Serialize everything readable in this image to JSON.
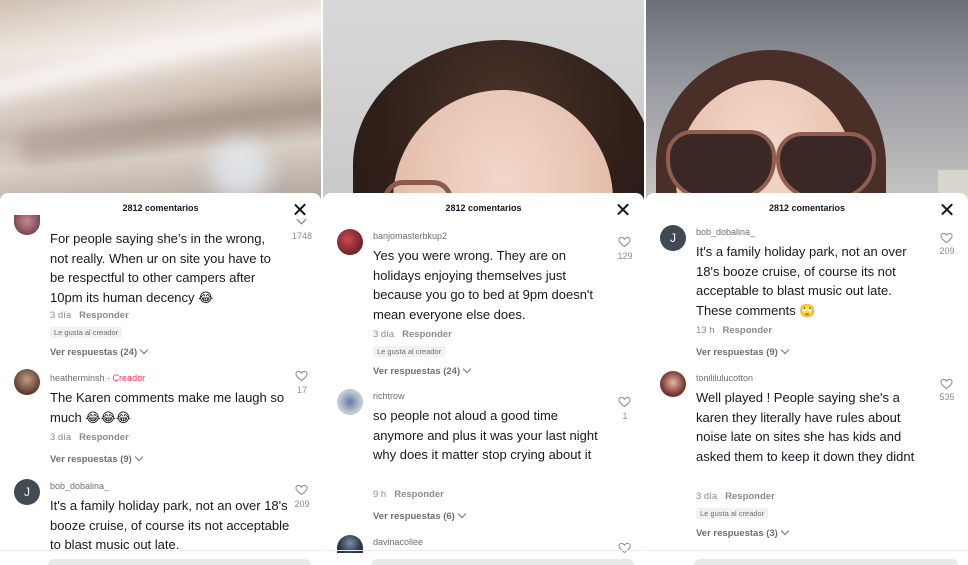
{
  "panels": [
    {
      "comment_count": "2812 comentarios",
      "comments": [
        {
          "text": "For people saying she’s in the wrong, not really. When ur on site you have to be respectful to other campers after 10pm its human decency 😂",
          "time": "3 día",
          "reply": "Responder",
          "liked_badge": "Le gusta al creador",
          "view_replies": "Ver respuestas (24)",
          "likes": "1748"
        },
        {
          "username": "heatherminsh",
          "creator_tag": "· Creador",
          "text": "The Karen comments make me laugh so much 😂😂😂",
          "time": "3 día",
          "reply": "Responder",
          "view_replies": "Ver respuestas (9)",
          "likes": "17"
        },
        {
          "username": "bob_dobalina_",
          "avatar_letter": "J",
          "text": "It's a family holiday park, not an over 18's booze cruise, of course its not acceptable to blast music out late.",
          "likes": "209"
        }
      ]
    },
    {
      "comment_count": "2812 comentarios",
      "comments": [
        {
          "username": "banjomasterbkup2",
          "text": "Yes you were wrong. They are on holidays enjoying themselves just because you go to bed at 9pm doesn't mean everyone else does.",
          "time": "3 día",
          "reply": "Responder",
          "liked_badge": "Le gusta al creador",
          "view_replies": "Ver respuestas (24)",
          "likes": "129"
        },
        {
          "username": "richtrow",
          "text": "so people not aloud a good time anymore and plus it was your last night why does it matter stop crying about it",
          "time": "9 h",
          "reply": "Responder",
          "view_replies": "Ver respuestas (6)",
          "likes": "1"
        },
        {
          "username": "davinacollee"
        }
      ]
    },
    {
      "comment_count": "2812 comentarios",
      "comments": [
        {
          "username": "bob_dobalina_",
          "avatar_letter": "J",
          "text": "It's a family holiday park, not an over 18's booze cruise, of course its not acceptable to blast music out late. These comments 🙄",
          "time": "13 h",
          "reply": "Responder",
          "view_replies": "Ver respuestas (9)",
          "likes": "209"
        },
        {
          "username": "tonililulucotton",
          "text": "Well played ! People saying she's a karen they literally have rules about noise late on sites she has kids and asked them to keep it down they didnt",
          "time": "3 día",
          "reply": "Responder",
          "liked_badge": "Le gusta al creador",
          "view_replies": "Ver respuestas (3)",
          "likes": "535"
        }
      ]
    }
  ],
  "colors": {
    "creator": "#fe2c55",
    "text": "#161823",
    "muted": "#8a8b91"
  },
  "icons": [
    "close-icon",
    "heart-icon",
    "chevron-down-icon"
  ]
}
